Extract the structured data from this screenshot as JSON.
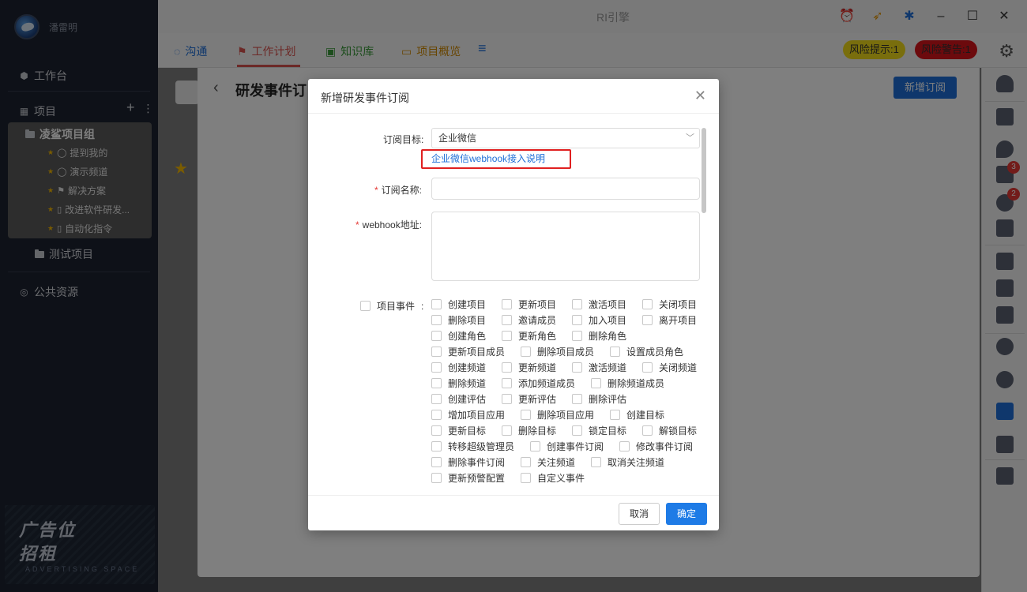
{
  "app": {
    "title": "RI引擎"
  },
  "user": {
    "name": "潘雷明"
  },
  "sidebar": {
    "workbench": "工作台",
    "projects": "项目",
    "group": {
      "title": "凌鲨项目组",
      "items": [
        "提到我的",
        "演示频道",
        "解决方案",
        "改进软件研发...",
        "自动化指令"
      ]
    },
    "test_project": "测试项目",
    "public_resources": "公共资源"
  },
  "ad": {
    "line1": "广告位",
    "line2": "招租",
    "sub": "ADVERTISING SPACE"
  },
  "tabs": [
    "沟通",
    "工作计划",
    "知识库",
    "项目概览"
  ],
  "risk": {
    "hint": "风险提示:1",
    "warn": "风险警告:1",
    "hint_color": "#f2dc1a",
    "warn_color": "#d9141b"
  },
  "right_badges": {
    "doc": "3",
    "bug": "2"
  },
  "page": {
    "title": "研发事件订",
    "new_subscribe": "新增订阅"
  },
  "modal": {
    "title": "新增研发事件订阅",
    "target_label": "订阅目标:",
    "target_value": "企业微信",
    "link": "企业微信webhook接入说明",
    "name_label": "订阅名称:",
    "webhook_label": "webhook地址:",
    "project_events_label": "项目事件",
    "events": [
      [
        "创建项目",
        "更新项目",
        "激活项目",
        "关闭项目"
      ],
      [
        "删除项目",
        "邀请成员",
        "加入项目",
        "离开项目"
      ],
      [
        "创建角色",
        "更新角色",
        "删除角色"
      ],
      [
        "更新项目成员",
        "删除项目成员",
        "设置成员角色"
      ],
      [
        "创建频道",
        "更新频道",
        "激活频道",
        "关闭频道"
      ],
      [
        "删除频道",
        "添加频道成员",
        "删除频道成员"
      ],
      [
        "创建评估",
        "更新评估",
        "删除评估"
      ],
      [
        "增加项目应用",
        "删除项目应用",
        "创建目标"
      ],
      [
        "更新目标",
        "删除目标",
        "锁定目标",
        "解锁目标"
      ],
      [
        "转移超级管理员",
        "创建事件订阅",
        "修改事件订阅"
      ],
      [
        "删除事件订阅",
        "关注频道",
        "取消关注频道"
      ],
      [
        "更新预警配置",
        "自定义事件"
      ]
    ],
    "cancel": "取消",
    "ok": "确定"
  }
}
